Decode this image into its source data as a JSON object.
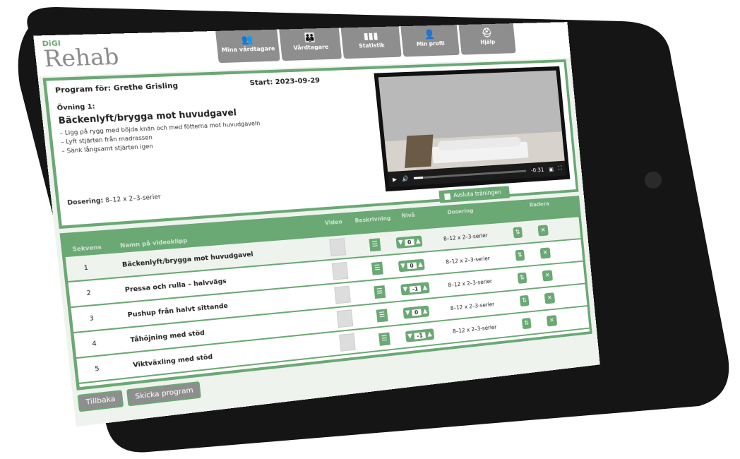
{
  "app": {
    "brand_small": "DiGI",
    "brand": "Rehab"
  },
  "nav": [
    {
      "label": "Mina vårdtagare",
      "icon": "group-icon"
    },
    {
      "label": "Vårdtagare",
      "icon": "users-icon"
    },
    {
      "label": "Statistik",
      "icon": "chart-icon"
    },
    {
      "label": "Min profil",
      "icon": "profile-icon"
    },
    {
      "label": "Hjälp",
      "icon": "help-icon"
    }
  ],
  "program": {
    "for_label": "Program för: Grethe Grisling",
    "start_label": "Start: 2023-09-29",
    "exercise_number": "Övning 1:",
    "exercise_title": "Bäckenlyft/brygga mot huvudgavel",
    "instructions": [
      "– Ligg på rygg med böjda knän och med fötterna mot huvudgaveln",
      "– Lyft stjärten från madrassen",
      "– Sänk långsamt stjärten igen"
    ],
    "dosering_label": "Dosering:",
    "dosering_value": "8–12 x 2–3-serier"
  },
  "video": {
    "time": "-0:31",
    "progress": 0.08
  },
  "finish_button": "Avsluta träningen",
  "table": {
    "headers": {
      "seq": "Sekvens",
      "name": "Namn på videoklipp",
      "video": "Video",
      "desc": "Beskrivning",
      "level": "Nivå",
      "dosering": "Dosering",
      "delete": "Radera"
    },
    "rows": [
      {
        "seq": "1",
        "name": "Bäckenlyft/brygga mot huvudgavel",
        "level": "0",
        "dosering": "8–12 x 2–3-serier"
      },
      {
        "seq": "2",
        "name": "Pressa och rulla – halvvägs",
        "level": "0",
        "dosering": "8–12 x 2–3-serier"
      },
      {
        "seq": "3",
        "name": "Pushup från halvt sittande",
        "level": "-1",
        "dosering": "8–12 x 2–3-serier"
      },
      {
        "seq": "4",
        "name": "Tåhöjning med stöd",
        "level": "0",
        "dosering": "8–12 x 2–3-serier"
      },
      {
        "seq": "5",
        "name": "Viktväxling med stöd",
        "level": "-1",
        "dosering": "8–12 x 2–3-serier"
      }
    ]
  },
  "footer": {
    "back": "Tillbaka",
    "send": "Skicka program"
  },
  "colors": {
    "accent": "#6aa874",
    "nav": "#8e8e8e",
    "frame": "#151515"
  }
}
